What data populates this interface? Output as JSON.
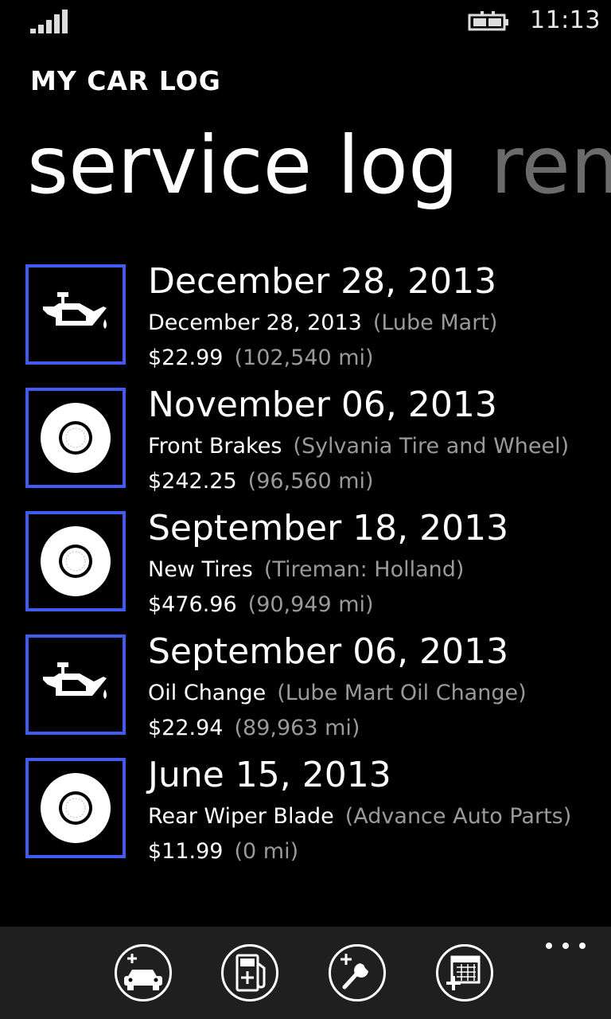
{
  "status": {
    "time": "11:13"
  },
  "app": {
    "title": "MY CAR LOG"
  },
  "pivot": {
    "active": "service log",
    "next": "rem"
  },
  "services": [
    {
      "date": "December 28, 2013",
      "name": "December 28, 2013",
      "shop": "(Lube Mart)",
      "cost": "$22.99",
      "mileage": "(102,540 mi)",
      "icon": "oil-can-icon"
    },
    {
      "date": "November 06, 2013",
      "name": "Front Brakes",
      "shop": "(Sylvania Tire and Wheel)",
      "cost": "$242.25",
      "mileage": "(96,560 mi)",
      "icon": "tire-icon"
    },
    {
      "date": "September 18, 2013",
      "name": "New Tires",
      "shop": "(Tireman: Holland)",
      "cost": "$476.96",
      "mileage": "(90,949 mi)",
      "icon": "tire-icon"
    },
    {
      "date": "September 06, 2013",
      "name": "Oil Change",
      "shop": "(Lube Mart Oil Change)",
      "cost": "$22.94",
      "mileage": "(89,963 mi)",
      "icon": "oil-can-icon"
    },
    {
      "date": "June 15, 2013",
      "name": "Rear Wiper Blade",
      "shop": "(Advance Auto Parts)",
      "cost": "$11.99",
      "mileage": "(0 mi)",
      "icon": "tire-icon"
    }
  ],
  "appbar": {
    "buttons": [
      "add-car-icon",
      "add-fuel-icon",
      "add-service-icon",
      "add-reminder-icon"
    ]
  },
  "colors": {
    "accent": "#3f5bf2",
    "secondary_text": "#9a9a9a",
    "appbar_bg": "#1f1f1f"
  }
}
